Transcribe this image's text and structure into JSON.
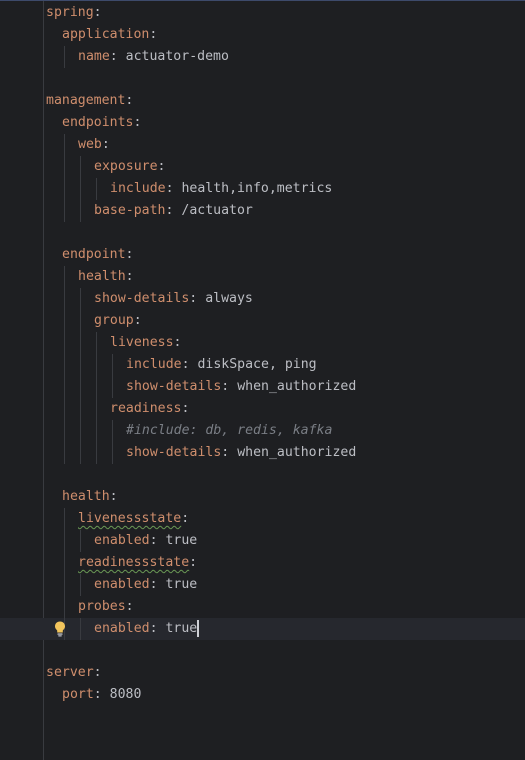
{
  "editor": {
    "lines": [
      {
        "indent": 0,
        "key": "spring",
        "value": "",
        "comment": ""
      },
      {
        "indent": 1,
        "key": "application",
        "value": "",
        "comment": ""
      },
      {
        "indent": 2,
        "key": "name",
        "value": "actuator-demo",
        "comment": ""
      },
      {
        "indent": 0,
        "key": "",
        "value": "",
        "comment": ""
      },
      {
        "indent": 0,
        "key": "management",
        "value": "",
        "comment": ""
      },
      {
        "indent": 1,
        "key": "endpoints",
        "value": "",
        "comment": ""
      },
      {
        "indent": 2,
        "key": "web",
        "value": "",
        "comment": ""
      },
      {
        "indent": 3,
        "key": "exposure",
        "value": "",
        "comment": ""
      },
      {
        "indent": 4,
        "key": "include",
        "value": "health,info,metrics",
        "comment": ""
      },
      {
        "indent": 3,
        "key": "base-path",
        "value": "/actuator",
        "comment": ""
      },
      {
        "indent": 0,
        "key": "",
        "value": "",
        "comment": ""
      },
      {
        "indent": 1,
        "key": "endpoint",
        "value": "",
        "comment": ""
      },
      {
        "indent": 2,
        "key": "health",
        "value": "",
        "comment": ""
      },
      {
        "indent": 3,
        "key": "show-details",
        "value": "always",
        "comment": ""
      },
      {
        "indent": 3,
        "key": "group",
        "value": "",
        "comment": ""
      },
      {
        "indent": 4,
        "key": "liveness",
        "value": "",
        "comment": ""
      },
      {
        "indent": 5,
        "key": "include",
        "value": "diskSpace, ping",
        "comment": ""
      },
      {
        "indent": 5,
        "key": "show-details",
        "value": "when_authorized",
        "comment": ""
      },
      {
        "indent": 4,
        "key": "readiness",
        "value": "",
        "comment": ""
      },
      {
        "indent": 5,
        "key": "",
        "value": "",
        "comment": "#include: db, redis, kafka"
      },
      {
        "indent": 5,
        "key": "show-details",
        "value": "when_authorized",
        "comment": ""
      },
      {
        "indent": 0,
        "key": "",
        "value": "",
        "comment": ""
      },
      {
        "indent": 1,
        "key": "health",
        "value": "",
        "comment": ""
      },
      {
        "indent": 2,
        "key": "livenessstate",
        "value": "",
        "comment": "",
        "warning": true
      },
      {
        "indent": 3,
        "key": "enabled",
        "value": "true",
        "comment": ""
      },
      {
        "indent": 2,
        "key": "readinessstate",
        "value": "",
        "comment": "",
        "warning": true
      },
      {
        "indent": 3,
        "key": "enabled",
        "value": "true",
        "comment": ""
      },
      {
        "indent": 2,
        "key": "probes",
        "value": "",
        "comment": ""
      },
      {
        "indent": 3,
        "key": "enabled",
        "value": "true",
        "comment": "",
        "current": true
      },
      {
        "indent": 0,
        "key": "",
        "value": "",
        "comment": ""
      },
      {
        "indent": 0,
        "key": "server",
        "value": "",
        "comment": ""
      },
      {
        "indent": 1,
        "key": "port",
        "value": "8080",
        "comment": ""
      }
    ],
    "intention_icon": "lightbulb-icon"
  },
  "colors": {
    "background": "#1e1f22",
    "key": "#cf8e6d",
    "value": "#bcbec4",
    "comment": "#7a7e85",
    "current_line": "#26282e",
    "bulb": "#f2c55c"
  }
}
